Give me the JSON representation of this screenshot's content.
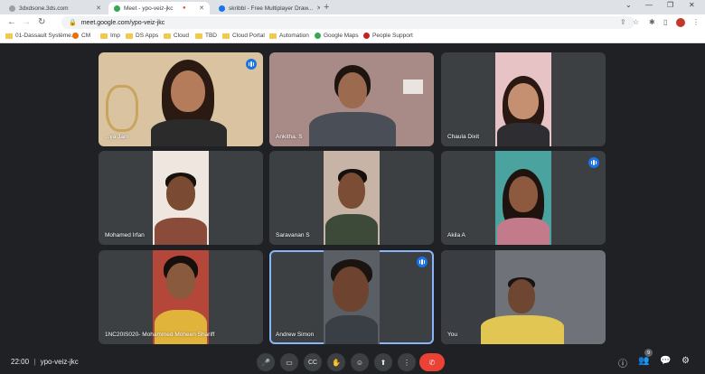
{
  "browser": {
    "tabs": [
      {
        "title": "3dxdsone.3ds.com",
        "favicon_color": "#9aa0a6"
      },
      {
        "title": "Meet - ypo-veiz-jkc",
        "favicon_color": "#34a853",
        "recording_dot": "●"
      },
      {
        "title": "skribbl - Free Multiplayer Draw...",
        "favicon_color": "#1a73e8"
      }
    ],
    "new_tab_label": "+",
    "window_controls": {
      "menu": "⌄",
      "minimize": "—",
      "maximize": "❐",
      "close": "✕"
    },
    "tab_close": "✕",
    "nav": {
      "back": "←",
      "forward": "→",
      "reload": "↻"
    },
    "url": "meet.google.com/ypo-veiz-jkc",
    "lock_icon": "🔒",
    "toolbar_icons": {
      "share": "⇪",
      "star": "☆",
      "extensions": "✱",
      "sidebar": "▯",
      "menu": "⋮"
    },
    "bookmarks": [
      {
        "label": "01-Dassault Système...",
        "kind": "folder"
      },
      {
        "label": "CM",
        "kind": "site"
      },
      {
        "label": "Imp",
        "kind": "folder"
      },
      {
        "label": "DS Apps",
        "kind": "folder"
      },
      {
        "label": "Cloud",
        "kind": "folder"
      },
      {
        "label": "TBD",
        "kind": "folder"
      },
      {
        "label": "Cloud Portal",
        "kind": "folder"
      },
      {
        "label": "Automation",
        "kind": "folder"
      },
      {
        "label": "Google Maps",
        "kind": "site"
      },
      {
        "label": "People Support",
        "kind": "site"
      }
    ]
  },
  "meet": {
    "participants": [
      {
        "name": "...ya Jain",
        "speaking_indicator": true
      },
      {
        "name": "Ankitha. S",
        "speaking_indicator": false
      },
      {
        "name": "Chaula Dixit",
        "speaking_indicator": false
      },
      {
        "name": "Mohamed Irfan",
        "speaking_indicator": false
      },
      {
        "name": "Saravanan S",
        "speaking_indicator": false
      },
      {
        "name": "Akila A",
        "speaking_indicator": true
      },
      {
        "name": "1NC20IS020- Mohammed Moheen Shariff",
        "speaking_indicator": false
      },
      {
        "name": "Andrew Simon",
        "speaking_indicator": true
      },
      {
        "name": "You",
        "speaking_indicator": false
      }
    ],
    "meeting_time": "22:00",
    "meeting_code": "ypo-veiz-jkc",
    "separator": "|",
    "controls": {
      "mic": "🎤",
      "camera": "▭",
      "captions": "CC",
      "raise_hand": "✋",
      "emoji": "☺",
      "present": "⬆",
      "more": "⋮",
      "leave": "✆"
    },
    "right_icons": {
      "info": "ⓘ",
      "people": "👥",
      "chat": "💬",
      "activities": "⚙"
    },
    "people_badge": "9",
    "accent_color": "#1a73e8",
    "leave_color": "#ea4335"
  }
}
